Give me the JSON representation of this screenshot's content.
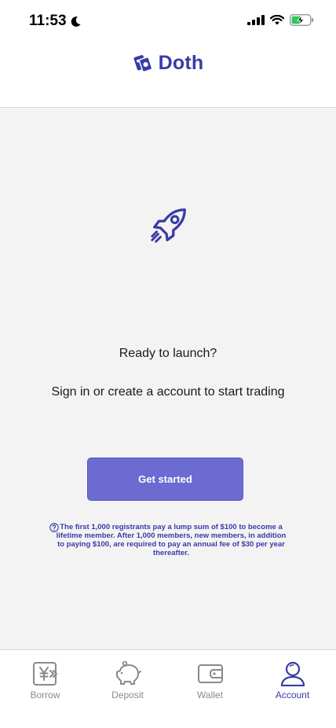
{
  "status_bar": {
    "time": "11:53"
  },
  "header": {
    "brand_name": "Doth"
  },
  "main": {
    "headline": "Ready to launch?",
    "subheadline": "Sign in or create a account to start trading",
    "cta_label": "Get started",
    "notice": "The first 1,000 registrants pay a lump sum of $100 to become a lifetime member. After 1,000 members, new members, in addition to paying $100, are required to pay an annual fee of $30 per year thereafter."
  },
  "tabbar": {
    "items": [
      {
        "label": "Borrow",
        "icon": "yen-transfer-icon"
      },
      {
        "label": "Deposit",
        "icon": "piggy-bank-icon"
      },
      {
        "label": "Wallet",
        "icon": "wallet-icon"
      },
      {
        "label": "Account",
        "icon": "user-icon"
      }
    ],
    "active": "Account"
  },
  "colors": {
    "brand": "#3a3aa8",
    "cta": "#6b6bd2",
    "background": "#f3f3f3"
  }
}
